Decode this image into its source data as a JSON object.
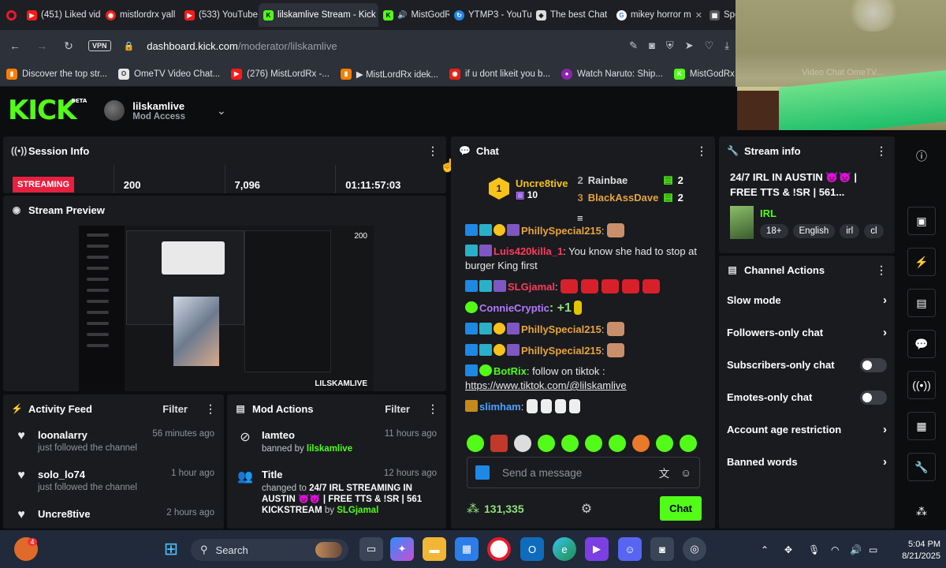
{
  "browser": {
    "tabs": [
      {
        "label": "(451) Liked vide",
        "icon": "youtube-icon"
      },
      {
        "label": "mistlordrx yall",
        "icon": "opera-icon"
      },
      {
        "label": "(533) YouTube",
        "icon": "youtube-icon"
      },
      {
        "label": "lilskamlive Stream - Kick",
        "icon": "kick-icon",
        "active": true
      },
      {
        "label": "MistGodRx",
        "icon": "kick-icon"
      },
      {
        "label": "YTMP3 - YouTu",
        "icon": "ytmp3-icon"
      },
      {
        "label": "The best Chat",
        "icon": "diamond-icon"
      },
      {
        "label": "mikey horror m",
        "icon": "google-icon"
      },
      {
        "label": "Speed Dial",
        "icon": "speed-dial-icon"
      }
    ],
    "vpn_label": "VPN",
    "url_host": "dashboard.kick.com",
    "url_path": "/moderator/lilskamlive",
    "bookmarks": [
      "Discover the top str...",
      "OmeTV Video Chat...",
      "(276) MistLordRx -...",
      "▶ MistLordRx idek...",
      "if u dont likeit you b...",
      "Watch Naruto: Ship...",
      "MistGodRx Stream -",
      "Video Chat OmeTV..."
    ]
  },
  "kick": {
    "logo": "KICK",
    "logo_sup": "BETA",
    "channel_name": "lilskamlive",
    "access": "Mod Access"
  },
  "session": {
    "title": "Session Info",
    "status": "STREAMING",
    "viewers": "200",
    "followers": "7,096",
    "duration": "01:11:57:03"
  },
  "preview": {
    "title": "Stream Preview",
    "watermark": "LILSKAMLIVE",
    "viewer_badge": "200"
  },
  "activity": {
    "title": "Activity Feed",
    "filter": "Filter",
    "items": [
      {
        "user": "loonalarry",
        "action": "just followed the channel",
        "time": "56 minutes ago"
      },
      {
        "user": "solo_lo74",
        "action": "just followed the channel",
        "time": "1 hour ago"
      },
      {
        "user": "Uncre8tive",
        "action": "",
        "time": "2 hours ago"
      }
    ]
  },
  "mod_actions": {
    "title": "Mod Actions",
    "filter": "Filter",
    "items": [
      {
        "user": "Iamteo",
        "pre": "banned by ",
        "by": "lilskamlive",
        "time": "11 hours ago"
      },
      {
        "user": "Title",
        "pre": "changed to ",
        "bold": "24/7 IRL STREAMING IN AUSTIN 😈👿 | FREE TTS & !SR | 561 KICKSTREAM",
        "mid": " by ",
        "by": "SLGjamal",
        "time": "12 hours ago"
      }
    ]
  },
  "chat": {
    "title": "Chat",
    "leaders": {
      "top_user": "Uncre8tive",
      "top_count": "10",
      "top_rank": "1",
      "second": {
        "rank": "2",
        "user": "Rainbae",
        "count": "2"
      },
      "third": {
        "rank": "3",
        "user": "BlackAssDave",
        "count": "2"
      }
    },
    "messages": [
      {
        "user": "PhillySpecial215",
        "text": ":",
        "color": "#e8a53a"
      },
      {
        "user": "Luis420killa_1",
        "text": ": You know she had to stop at burger King first",
        "color": "#ff3b5c"
      },
      {
        "user": "SLGjamal",
        "text": ":",
        "color": "#ff3b5c"
      },
      {
        "user": "ConnieCryptic",
        "text": ": +1",
        "color": "#b37aff"
      },
      {
        "user": "PhillySpecial215",
        "text": ":",
        "color": "#e8a53a"
      },
      {
        "user": "PhillySpecial215",
        "text": ":",
        "color": "#e8a53a"
      },
      {
        "user": "BotRix",
        "text": ": follow on tiktok :",
        "link": "https://www.tiktok.com/@lilskamlive",
        "color": "#53fc18"
      },
      {
        "user": "slimham",
        "text": ":",
        "color": "#4aa3ff"
      }
    ],
    "placeholder": "Send a message",
    "points": "131,335",
    "send_label": "Chat"
  },
  "stream_info": {
    "title": "Stream info",
    "stream_title": "24/7 IRL IN AUSTIN 😈👿 | FREE TTS & !SR | 561...",
    "category": "IRL",
    "tags": [
      "18+",
      "English",
      "irl",
      "cl"
    ]
  },
  "channel_actions": {
    "title": "Channel Actions",
    "items": [
      {
        "label": "Slow mode",
        "kind": "arrow"
      },
      {
        "label": "Followers-only chat",
        "kind": "arrow"
      },
      {
        "label": "Subscribers-only chat",
        "kind": "toggle"
      },
      {
        "label": "Emotes-only chat",
        "kind": "toggle"
      },
      {
        "label": "Account age restriction",
        "kind": "arrow"
      },
      {
        "label": "Banned words",
        "kind": "arrow"
      }
    ]
  },
  "taskbar": {
    "search": "Search",
    "time": "5:04 PM",
    "date": "8/21/2025",
    "badge_count": "4"
  },
  "colors": {
    "kick_green": "#53fc18",
    "streaming_red": "#e8203f",
    "panel_bg": "#191b1f",
    "page_bg": "#0b0d0f"
  }
}
